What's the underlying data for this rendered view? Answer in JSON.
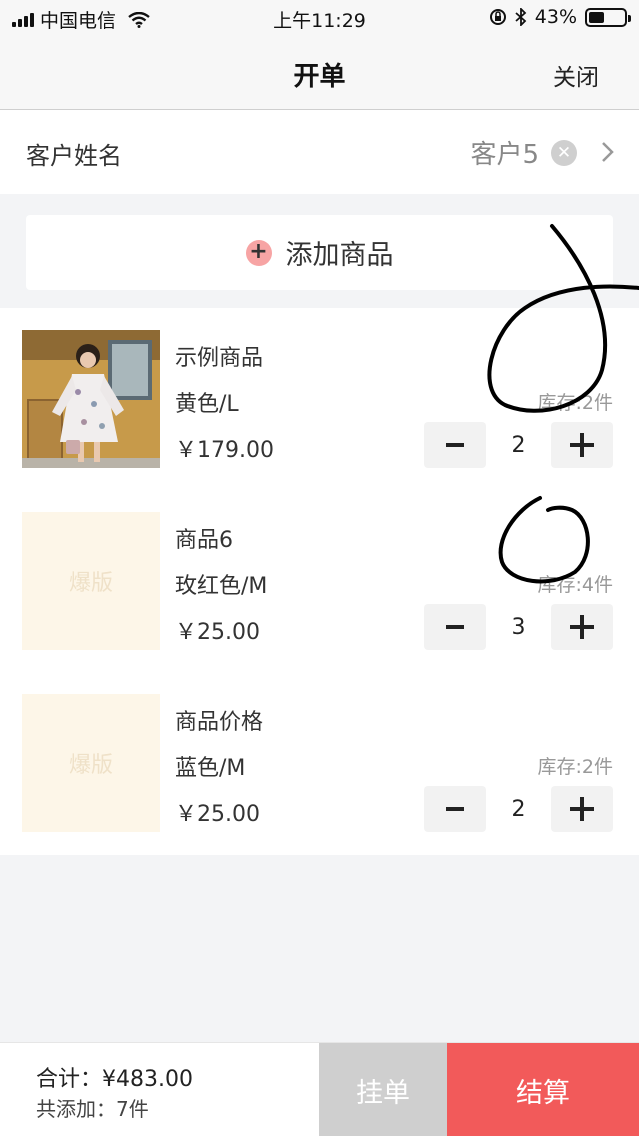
{
  "status": {
    "carrier": "中国电信",
    "time": "上午11:29",
    "battery": "43%",
    "battery_level": 0.43
  },
  "nav": {
    "title": "开单",
    "close": "关闭"
  },
  "customer": {
    "label": "客户姓名",
    "value": "客户5"
  },
  "add_product": {
    "label": "添加商品"
  },
  "items": [
    {
      "name": "示例商品",
      "spec": "黄色/L",
      "price": "￥179.00",
      "stock": "库存:2件",
      "qty": "2",
      "placeholder": ""
    },
    {
      "name": "商品6",
      "spec": "玫红色/M",
      "price": "￥25.00",
      "stock": "库存:4件",
      "qty": "3",
      "placeholder": "爆版"
    },
    {
      "name": "商品价格",
      "spec": "蓝色/M",
      "price": "￥25.00",
      "stock": "库存:2件",
      "qty": "2",
      "placeholder": "爆版"
    }
  ],
  "footer": {
    "total": "合计：¥483.00",
    "count": "共添加：7件",
    "hold": "挂单",
    "checkout": "结算"
  },
  "colors": {
    "accent": "#f25a5a",
    "hold": "#cfcfcf",
    "plus_icon": "#f7a4a4"
  }
}
